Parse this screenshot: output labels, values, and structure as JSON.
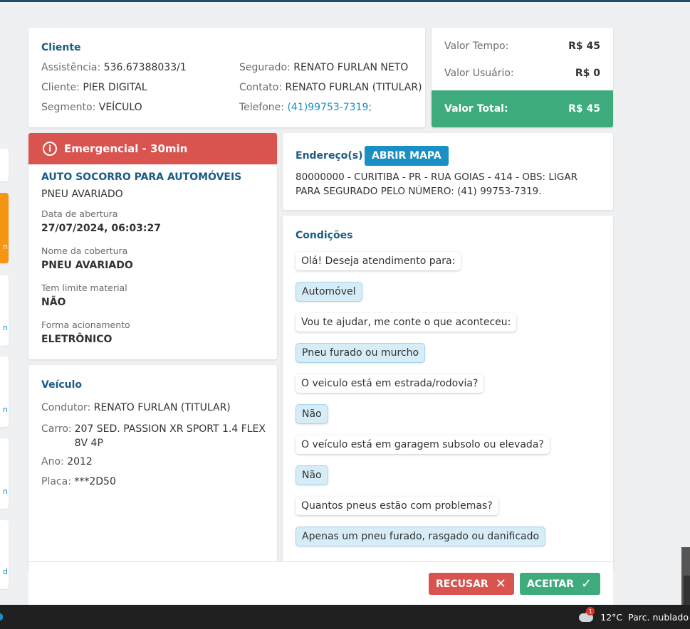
{
  "cliente": {
    "title": "Cliente",
    "assistencia_label": "Assistência:",
    "assistencia_value": "536.67388033/1",
    "cliente_label": "Cliente:",
    "cliente_value": "PIER DIGITAL",
    "segmento_label": "Segmento:",
    "segmento_value": "VEÍCULO",
    "segurado_label": "Segurado:",
    "segurado_value": "RENATO FURLAN NETO",
    "contato_label": "Contato:",
    "contato_value": "RENATO FURLAN (TITULAR)",
    "telefone_label": "Telefone:",
    "telefone_value": "(41)99753-7319;"
  },
  "valores": {
    "tempo_label": "Valor Tempo:",
    "tempo_value": "R$ 45",
    "usuario_label": "Valor Usuário:",
    "usuario_value": "R$ 0",
    "total_label": "Valor Total:",
    "total_value": "R$ 45",
    "total_color": "#3dab7b"
  },
  "servico": {
    "priority_label": "Emergencial - 30min",
    "priority_color": "#d9534f",
    "title": "AUTO SOCORRO PARA AUTOMÓVEIS",
    "subtitle": "PNEU AVARIADO",
    "fields": [
      {
        "label": "Data de abertura",
        "value": "27/07/2024, 06:03:27"
      },
      {
        "label": "Nome da cobertura",
        "value": "PNEU AVARIADO"
      },
      {
        "label": "Tem limite material",
        "value": "NÃO"
      },
      {
        "label": "Forma acionamento",
        "value": "ELETRÔNICO"
      }
    ]
  },
  "endereco": {
    "title": "Endereço(s)",
    "map_button": "ABRIR MAPA",
    "address": "80000000 - CURITIBA - PR - RUA GOIAS - 414 - OBS: LIGAR PARA SEGURADO PELO NÚMERO: (41) 99753-7319."
  },
  "veiculo": {
    "title": "Veículo",
    "condutor_label": "Condutor:",
    "condutor_value": "RENATO FURLAN (TITULAR)",
    "carro_label": "Carro:",
    "carro_value": "207 SED. PASSION XR SPORT 1.4 FLEX 8V 4P",
    "ano_label": "Ano:",
    "ano_value": "2012",
    "placa_label": "Placa:",
    "placa_value": "***2D50"
  },
  "condicoes": {
    "title": "Condições",
    "messages": [
      {
        "type": "question",
        "text": "Olá! Deseja atendimento para:"
      },
      {
        "type": "answer",
        "text": "Automóvel"
      },
      {
        "type": "question",
        "text": "Vou te ajudar, me conte o que aconteceu:"
      },
      {
        "type": "answer",
        "text": "Pneu furado ou murcho"
      },
      {
        "type": "question",
        "text": "O veiculo está em estrada/rodovia?"
      },
      {
        "type": "answer",
        "text": "Não"
      },
      {
        "type": "question",
        "text": "O veículo está em garagem subsolo ou elevada?"
      },
      {
        "type": "answer",
        "text": "Não"
      },
      {
        "type": "question",
        "text": "Quantos pneus estão com problemas?"
      },
      {
        "type": "answer",
        "text": "Apenas um pneu furado, rasgado ou danificado"
      }
    ]
  },
  "actions": {
    "reject_label": "RECUSAR",
    "accept_label": "ACEITAR",
    "reject_icon": "close-icon",
    "accept_icon": "check-icon"
  },
  "left_cards": [
    {
      "char": ""
    },
    {
      "char": "n"
    },
    {
      "char": "n"
    },
    {
      "char": "n"
    },
    {
      "char": "n"
    },
    {
      "char": "d"
    }
  ],
  "taskbar": {
    "temperature": "12°C",
    "weather": "Parc. nublado",
    "weather_badge": "1",
    "weather_icon": "partly-cloudy-icon"
  }
}
